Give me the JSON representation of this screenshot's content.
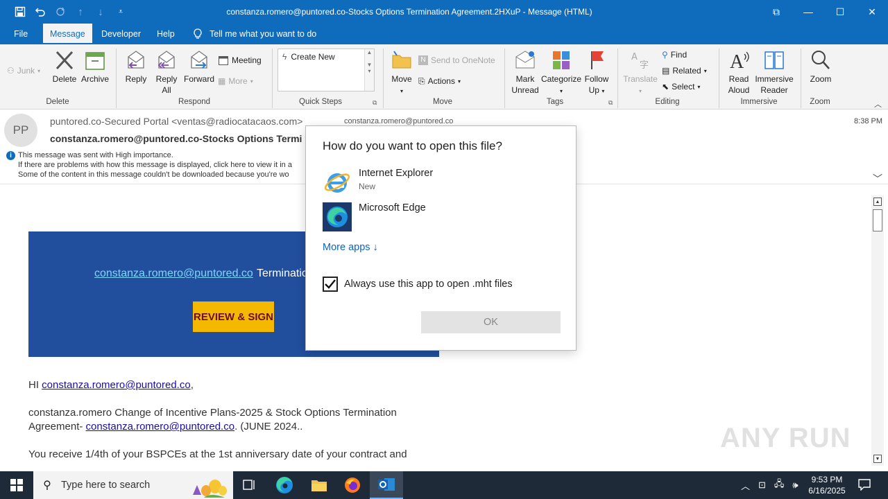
{
  "window": {
    "title": "constanza.romero@puntored.co-Stocks Options Termination Agreement.2HXuP  -  Message (HTML)",
    "controls": {
      "restore": "⧉",
      "minimize": "—",
      "maximize": "☐",
      "close": "✕"
    }
  },
  "tabs": [
    "File",
    "Message",
    "Developer",
    "Help"
  ],
  "active_tab": "Message",
  "tell_me": "Tell me what you want to do",
  "ribbon": {
    "junk": "Junk",
    "delete": "Delete",
    "archive": "Archive",
    "reply": "Reply",
    "reply_all_1": "Reply",
    "reply_all_2": "All",
    "forward": "Forward",
    "meeting": "Meeting",
    "more": "More",
    "quick_steps_item": "Create New",
    "move": "Move",
    "send_to_onenote": "Send to OneNote",
    "actions": "Actions",
    "mark_unread_1": "Mark",
    "mark_unread_2": "Unread",
    "categorize": "Categorize",
    "follow_up_1": "Follow",
    "follow_up_2": "Up",
    "translate": "Translate",
    "find": "Find",
    "related": "Related",
    "select": "Select",
    "read_aloud_1": "Read",
    "read_aloud_2": "Aloud",
    "immersive_1": "Immersive",
    "immersive_2": "Reader",
    "zoom": "Zoom",
    "groups": {
      "delete": "Delete",
      "respond": "Respond",
      "quick_steps": "Quick Steps",
      "move": "Move",
      "tags": "Tags",
      "editing": "Editing",
      "immersive": "Immersive",
      "zoom": "Zoom"
    }
  },
  "message": {
    "avatar_initials": "PP",
    "from": "puntored.co-Secured Portal <ventas@radiocatacaos.com>",
    "subject": "constanza.romero@puntored.co-Stocks Options Termi",
    "to": "constanza.romero@puntored.co",
    "time": "8:38 PM",
    "info_1": "This message was sent with High importance.",
    "info_2": "If there are problems with how this message is displayed, click here to view it in a",
    "info_3": "Some of the content in this message couldn't be downloaded because you're wo"
  },
  "body": {
    "banner_email": "constanza.romero@puntored.co",
    "banner_rest": " Terminatio",
    "review_button": "REVIEW & SIGN",
    "greeting_prefix": "HI ",
    "greeting_link": "constanza.romero@puntored.co",
    "greeting_suffix": ",",
    "para1_line1": "constanza.romero Change of Incentive Plans-2025 & Stock Options Termination",
    "para1_line2_prefix": "Agreement- ",
    "para1_line2_link": "constanza.romero@puntored.co",
    "para1_line2_suffix": ". (JUNE 2024..",
    "para2_line1": "You receive 1/4th of your BSPCEs at the 1st anniversary date of your contract and"
  },
  "dialog": {
    "title": "How do you want to open this file?",
    "app1_name": "Internet Explorer",
    "app1_sub": "New",
    "app2_name": "Microsoft Edge",
    "more_apps": "More apps  ↓",
    "always_label": "Always use this app to open .mht files",
    "always_checked": true,
    "ok": "OK"
  },
  "watermark": "ANY RUN",
  "taskbar": {
    "search_placeholder": "Type here to search",
    "time": "9:53 PM",
    "date": "6/16/2025"
  },
  "colors": {
    "accent": "#0f6cbd",
    "banner": "#214f9e",
    "review_button": "#f5b800",
    "taskbar": "#1e2a38"
  }
}
